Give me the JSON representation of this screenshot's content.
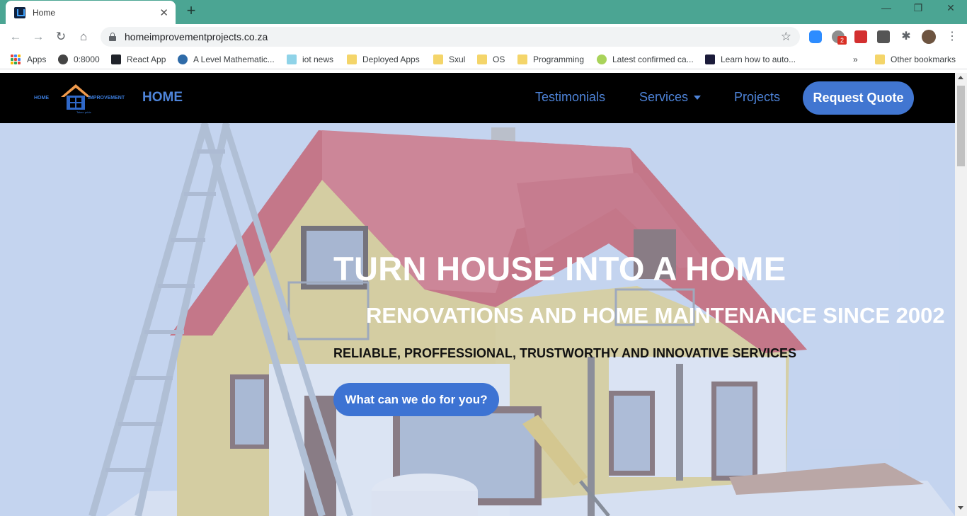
{
  "browser": {
    "tab_title": "Home",
    "new_tab_symbol": "+",
    "url": "homeimprovementprojects.co.za",
    "extension_badge": "2",
    "window_controls": {
      "minimize": "—",
      "restore": "❐",
      "close": "✕"
    }
  },
  "bookmarks": {
    "apps": "Apps",
    "items": [
      "0:8000",
      "React App",
      "A Level Mathematic...",
      "iot news",
      "Deployed Apps",
      "Sxul",
      "OS",
      "Programming",
      "Latest confirmed ca...",
      "Learn how to auto..."
    ],
    "overflow": "»",
    "other": "Other bookmarks"
  },
  "site": {
    "logo": {
      "left_text": "HOME",
      "right_text": "IMPROVEMENT",
      "tagline": "Taken pride"
    },
    "nav": {
      "home": "HOME",
      "testimonials": "Testimonials",
      "services": "Services",
      "projects": "Projects",
      "request_quote": "Request Quote"
    },
    "hero": {
      "title": "TURN HOUSE INTO A HOME",
      "subtitle": "RENOVATIONS AND HOME MAINTENANCE SINCE 2002",
      "tagline": "RELIABLE, PROFFESSIONAL, TRUSTWORTHY AND INNOVATIVE SERVICES",
      "cta": "What can we do for you?"
    }
  },
  "colors": {
    "tabbar": "#4ba593",
    "nav_bg": "#000000",
    "nav_link": "#4e84d9",
    "button": "#4176d1",
    "roof": "#c8414b",
    "wall": "#e2cc73"
  }
}
